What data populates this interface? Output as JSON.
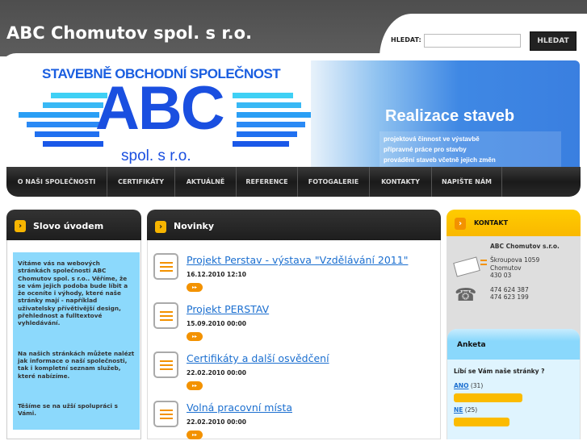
{
  "header": {
    "title": "ABC Chomutov spol. s r.o.",
    "search_label": "HLEDAT:",
    "search_value": "",
    "search_button": "HLEDAT"
  },
  "logo": {
    "tagline": "STAVEBNĚ OBCHODNÍ SPOLEČNOST",
    "name": "ABC",
    "suffix": "spol. s r.o."
  },
  "banner": {
    "title": "Realizace staveb",
    "lines": [
      "projektová činnost ve výstavbě",
      "přípravné práce pro stavby",
      "provádění staveb včetně jejich změn"
    ]
  },
  "nav": [
    "O NAŠI SPOLEČNOSTI",
    "CERTIFIKÁTY",
    "AKTUÁLNĚ",
    "REFERENCE",
    "FOTOGALERIE",
    "KONTAKTY",
    "NAPIŠTE NÁM"
  ],
  "intro": {
    "title": "Slovo úvodem",
    "paragraphs": [
      "Vítáme vás na webových stránkách společnosti ABC Chomutov spol. s r.o.. Věříme, že se vám jejich podoba bude líbit a že oceníte i výhody, které naše stránky mají - například uživatelsky přívětivější design, přehlednost a fulltextové vyhledávání.",
      "Na našich stránkách můžete nalézt jak informace o naší společnosti, tak i kompletní seznam služeb, které nabízíme.",
      "Těšíme se na užší spolupráci s Vámi."
    ]
  },
  "news": {
    "title": "Novinky",
    "more_label": "▸▸",
    "items": [
      {
        "title": "Projekt Perstav - výstava \"Vzdělávání 2011\"",
        "date": "16.12.2010 12:10"
      },
      {
        "title": "Projekt PERSTAV",
        "date": "15.09.2010 00:00"
      },
      {
        "title": "Certifikáty a další osvědčení",
        "date": "22.02.2010 00:00"
      },
      {
        "title": "Volná pracovní místa",
        "date": "22.02.2010 00:00"
      }
    ]
  },
  "contact": {
    "title": "KONTAKT",
    "company": "ABC Chomutov s.r.o.",
    "street": "Škroupova 1059",
    "city": "Chomutov",
    "zip": "430 03",
    "phone1": "474 624 387",
    "phone2": "474 623 199"
  },
  "poll": {
    "title": "Anketa",
    "question": "Líbí se Vám naše stránky ?",
    "options": [
      {
        "label": "ANO",
        "count": "(31)",
        "value": 31
      },
      {
        "label": "NE",
        "count": "(25)",
        "value": 25
      }
    ]
  },
  "colors": {
    "accent": "#f39200",
    "link": "#1b6fd0",
    "brand": "#1a4fe0"
  }
}
